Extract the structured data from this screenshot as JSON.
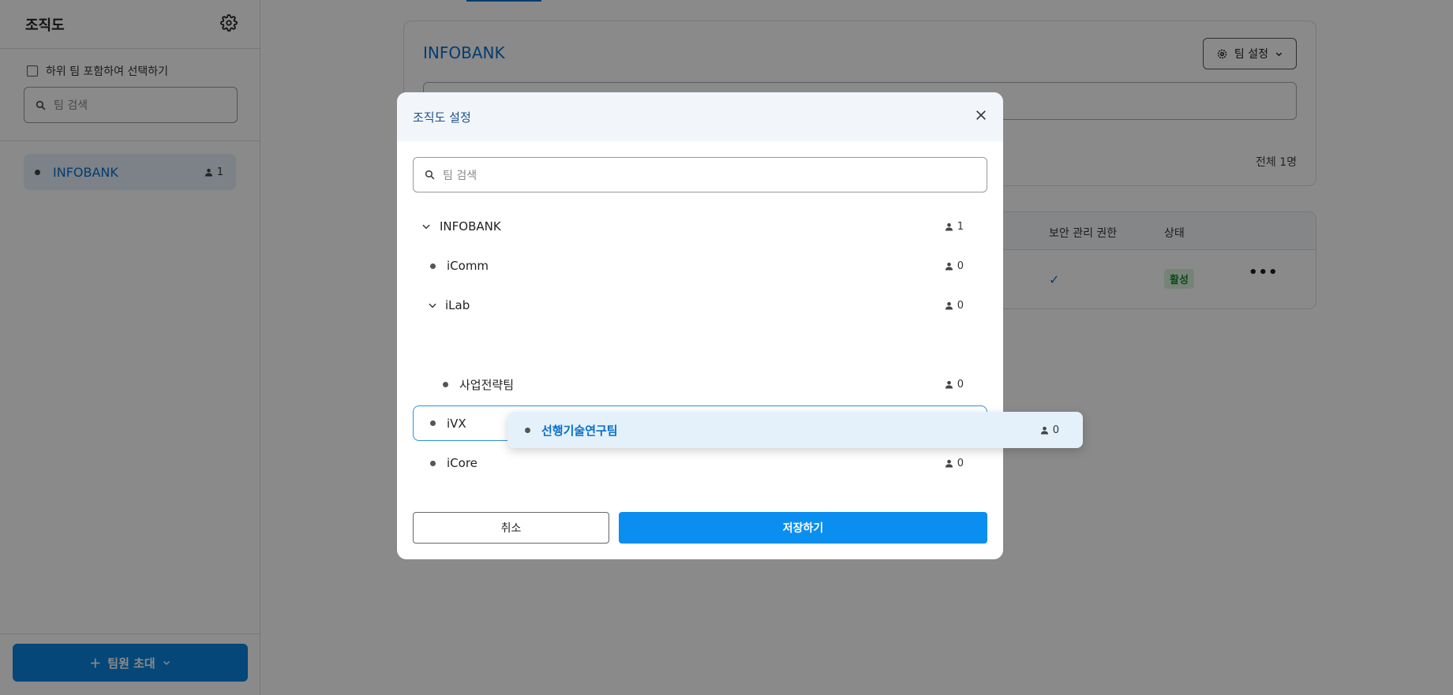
{
  "sidebar": {
    "title": "조직도",
    "include_subteams_label": "하위 팀 포함하여 선택하기",
    "search_placeholder": "팀 검색",
    "items": [
      {
        "label": "INFOBANK",
        "count": "1"
      }
    ],
    "invite_label": "팀원 초대"
  },
  "main": {
    "card_title": "INFOBANK",
    "team_settings_label": "팀 설정",
    "total_count": "전체 1명",
    "table": {
      "headers": [
        "보안 관리 권한",
        "상태"
      ],
      "rows": [
        {
          "security": "✓",
          "status": "활성",
          "more": "•••"
        }
      ]
    }
  },
  "modal": {
    "title": "조직도 설정",
    "search_placeholder": "팀 검색",
    "tree": [
      {
        "label": "INFOBANK",
        "count": "1",
        "expanded": true,
        "level": 0
      },
      {
        "label": "iComm",
        "count": "0",
        "level": 1
      },
      {
        "label": "iLab",
        "count": "0",
        "expanded": true,
        "level": 1
      },
      {
        "label": "사업전략팀",
        "count": "0",
        "level": 2
      },
      {
        "label": "iVX",
        "count": "0",
        "level": 1,
        "drop_target": true
      },
      {
        "label": "iCore",
        "count": "0",
        "level": 1
      }
    ],
    "cancel_label": "취소",
    "save_label": "저장하기"
  },
  "drag_ghost": {
    "label": "선행기술연구팀",
    "count": "0"
  },
  "colors": {
    "accent": "#0a6fc9",
    "primary_button": "#0a8ef0",
    "drop_border": "#2c90e0",
    "status_green": "#1a8a2e"
  }
}
